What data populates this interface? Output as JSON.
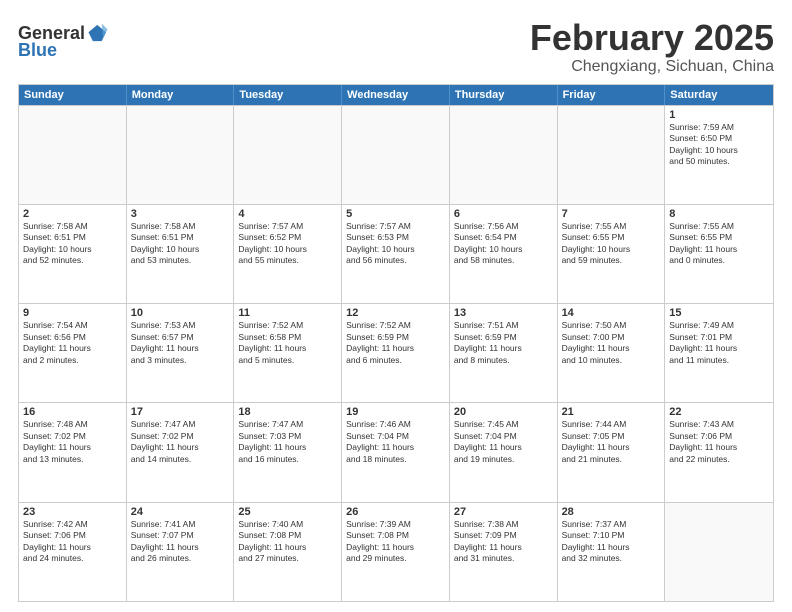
{
  "logo": {
    "line1": "General",
    "line2": "Blue"
  },
  "title": "February 2025",
  "subtitle": "Chengxiang, Sichuan, China",
  "days_of_week": [
    "Sunday",
    "Monday",
    "Tuesday",
    "Wednesday",
    "Thursday",
    "Friday",
    "Saturday"
  ],
  "weeks": [
    [
      {
        "day": "",
        "info": ""
      },
      {
        "day": "",
        "info": ""
      },
      {
        "day": "",
        "info": ""
      },
      {
        "day": "",
        "info": ""
      },
      {
        "day": "",
        "info": ""
      },
      {
        "day": "",
        "info": ""
      },
      {
        "day": "1",
        "info": "Sunrise: 7:59 AM\nSunset: 6:50 PM\nDaylight: 10 hours\nand 50 minutes."
      }
    ],
    [
      {
        "day": "2",
        "info": "Sunrise: 7:58 AM\nSunset: 6:51 PM\nDaylight: 10 hours\nand 52 minutes."
      },
      {
        "day": "3",
        "info": "Sunrise: 7:58 AM\nSunset: 6:51 PM\nDaylight: 10 hours\nand 53 minutes."
      },
      {
        "day": "4",
        "info": "Sunrise: 7:57 AM\nSunset: 6:52 PM\nDaylight: 10 hours\nand 55 minutes."
      },
      {
        "day": "5",
        "info": "Sunrise: 7:57 AM\nSunset: 6:53 PM\nDaylight: 10 hours\nand 56 minutes."
      },
      {
        "day": "6",
        "info": "Sunrise: 7:56 AM\nSunset: 6:54 PM\nDaylight: 10 hours\nand 58 minutes."
      },
      {
        "day": "7",
        "info": "Sunrise: 7:55 AM\nSunset: 6:55 PM\nDaylight: 10 hours\nand 59 minutes."
      },
      {
        "day": "8",
        "info": "Sunrise: 7:55 AM\nSunset: 6:55 PM\nDaylight: 11 hours\nand 0 minutes."
      }
    ],
    [
      {
        "day": "9",
        "info": "Sunrise: 7:54 AM\nSunset: 6:56 PM\nDaylight: 11 hours\nand 2 minutes."
      },
      {
        "day": "10",
        "info": "Sunrise: 7:53 AM\nSunset: 6:57 PM\nDaylight: 11 hours\nand 3 minutes."
      },
      {
        "day": "11",
        "info": "Sunrise: 7:52 AM\nSunset: 6:58 PM\nDaylight: 11 hours\nand 5 minutes."
      },
      {
        "day": "12",
        "info": "Sunrise: 7:52 AM\nSunset: 6:59 PM\nDaylight: 11 hours\nand 6 minutes."
      },
      {
        "day": "13",
        "info": "Sunrise: 7:51 AM\nSunset: 6:59 PM\nDaylight: 11 hours\nand 8 minutes."
      },
      {
        "day": "14",
        "info": "Sunrise: 7:50 AM\nSunset: 7:00 PM\nDaylight: 11 hours\nand 10 minutes."
      },
      {
        "day": "15",
        "info": "Sunrise: 7:49 AM\nSunset: 7:01 PM\nDaylight: 11 hours\nand 11 minutes."
      }
    ],
    [
      {
        "day": "16",
        "info": "Sunrise: 7:48 AM\nSunset: 7:02 PM\nDaylight: 11 hours\nand 13 minutes."
      },
      {
        "day": "17",
        "info": "Sunrise: 7:47 AM\nSunset: 7:02 PM\nDaylight: 11 hours\nand 14 minutes."
      },
      {
        "day": "18",
        "info": "Sunrise: 7:47 AM\nSunset: 7:03 PM\nDaylight: 11 hours\nand 16 minutes."
      },
      {
        "day": "19",
        "info": "Sunrise: 7:46 AM\nSunset: 7:04 PM\nDaylight: 11 hours\nand 18 minutes."
      },
      {
        "day": "20",
        "info": "Sunrise: 7:45 AM\nSunset: 7:04 PM\nDaylight: 11 hours\nand 19 minutes."
      },
      {
        "day": "21",
        "info": "Sunrise: 7:44 AM\nSunset: 7:05 PM\nDaylight: 11 hours\nand 21 minutes."
      },
      {
        "day": "22",
        "info": "Sunrise: 7:43 AM\nSunset: 7:06 PM\nDaylight: 11 hours\nand 22 minutes."
      }
    ],
    [
      {
        "day": "23",
        "info": "Sunrise: 7:42 AM\nSunset: 7:06 PM\nDaylight: 11 hours\nand 24 minutes."
      },
      {
        "day": "24",
        "info": "Sunrise: 7:41 AM\nSunset: 7:07 PM\nDaylight: 11 hours\nand 26 minutes."
      },
      {
        "day": "25",
        "info": "Sunrise: 7:40 AM\nSunset: 7:08 PM\nDaylight: 11 hours\nand 27 minutes."
      },
      {
        "day": "26",
        "info": "Sunrise: 7:39 AM\nSunset: 7:08 PM\nDaylight: 11 hours\nand 29 minutes."
      },
      {
        "day": "27",
        "info": "Sunrise: 7:38 AM\nSunset: 7:09 PM\nDaylight: 11 hours\nand 31 minutes."
      },
      {
        "day": "28",
        "info": "Sunrise: 7:37 AM\nSunset: 7:10 PM\nDaylight: 11 hours\nand 32 minutes."
      },
      {
        "day": "",
        "info": ""
      }
    ]
  ]
}
